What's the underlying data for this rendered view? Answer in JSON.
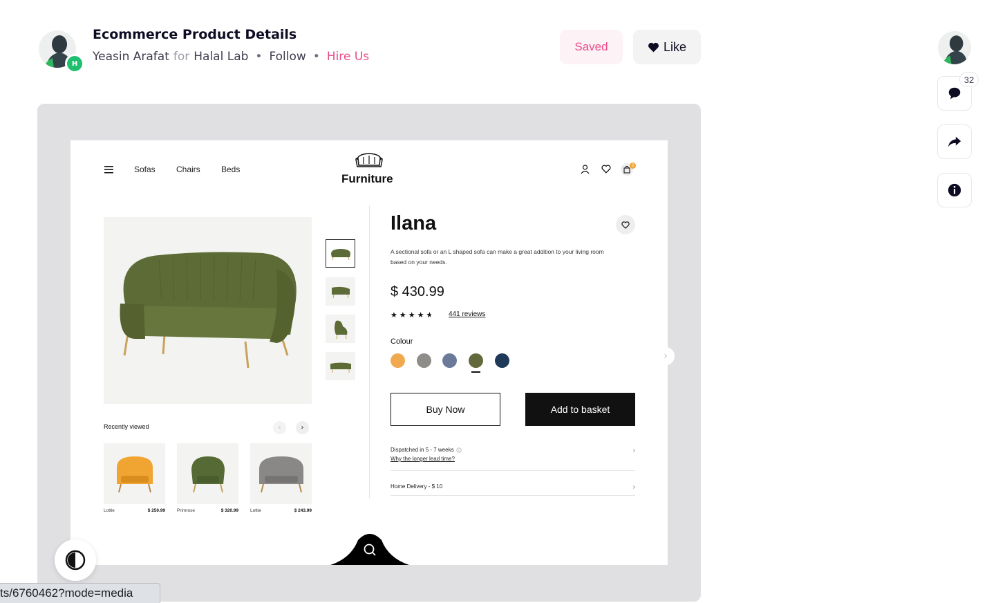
{
  "header": {
    "title": "Ecommerce Product Details",
    "author": "Yeasin Arafat",
    "for_label": "for",
    "team": "Halal Lab",
    "follow": "Follow",
    "hire": "Hire Us",
    "saved_label": "Saved",
    "like_label": "Like",
    "badge_text": "H"
  },
  "rail": {
    "comment_count": "32"
  },
  "shot": {
    "nav": [
      "Sofas",
      "Chairs",
      "Beds"
    ],
    "brand": "Furniture",
    "cart_count": "2",
    "product": {
      "name": "Ilana",
      "description": "A sectional sofa or an L shaped sofa can make a great addition to your living room based on your needs.",
      "price": "$ 430.99",
      "rating": 4.5,
      "reviews": "441 reviews",
      "colour_label": "Colour",
      "colours": [
        "#f0a94e",
        "#8f8d89",
        "#6b7a99",
        "#63693c",
        "#1f3a58"
      ],
      "selected_colour_index": 3,
      "buy_now": "Buy Now",
      "add_to_basket": "Add to basket"
    },
    "info": {
      "dispatch": "Dispatched in 5 - 7 weeks",
      "dispatch_link": "Why the longer lead time?",
      "delivery": "Home Delivery - $ 10"
    },
    "recently_viewed": {
      "title": "Recently viewed",
      "items": [
        {
          "name": "Lottie",
          "price": "$ 250.99",
          "color": "#f0a432"
        },
        {
          "name": "Primrose",
          "price": "$ 320.99",
          "color": "#556a34"
        },
        {
          "name": "Lottie",
          "price": "$ 243.99",
          "color": "#8a8886"
        }
      ]
    }
  },
  "status_bar": {
    "url": "ts/6760462?mode=media"
  },
  "colors": {
    "accent": "#ea4c89",
    "sofa_green": "#5d6b36",
    "frame_bg": "#e0e0e3"
  }
}
